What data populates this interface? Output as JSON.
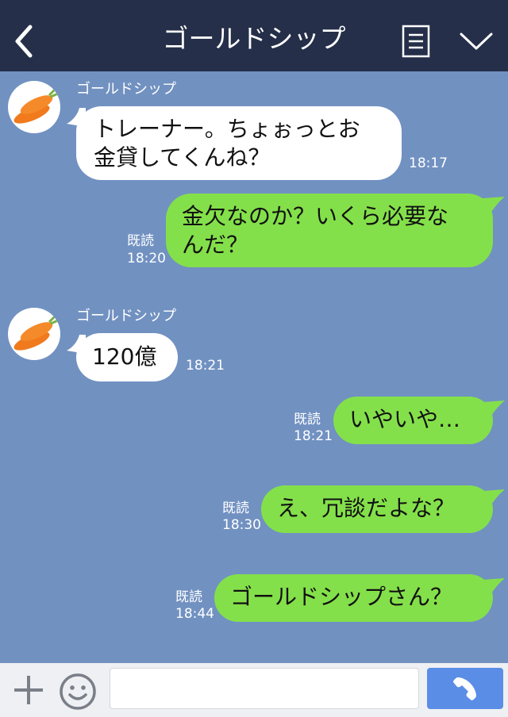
{
  "header": {
    "title": "ゴールドシップ",
    "back_icon": "chevron-left-icon",
    "menu_icon": "menu-list-icon",
    "collapse_icon": "chevron-down-icon"
  },
  "messages": [
    {
      "direction": "incoming",
      "sender": "ゴールドシップ",
      "lines": [
        "トレーナー。ちょぉっとお",
        "金貸してくんね？"
      ],
      "time": "18:17"
    },
    {
      "direction": "outgoing",
      "read": "既読",
      "lines": [
        "金欠なのか？いくら必要な",
        "んだ？"
      ],
      "time": "18:20"
    },
    {
      "direction": "incoming",
      "sender": "ゴールドシップ",
      "lines": [
        "120億"
      ],
      "time": "18:21"
    },
    {
      "direction": "outgoing",
      "read": "既読",
      "lines": [
        "いやいや…"
      ],
      "time": "18:21"
    },
    {
      "direction": "outgoing",
      "read": "既読",
      "lines": [
        "え、冗談だよな？"
      ],
      "time": "18:30"
    },
    {
      "direction": "outgoing",
      "read": "既読",
      "lines": [
        "ゴールドシップさん？"
      ],
      "time": "18:44"
    }
  ],
  "input_bar": {
    "plus_icon": "plus-icon",
    "emoji_icon": "smiley-icon",
    "message_value": "",
    "call_icon": "phone-icon"
  },
  "colors": {
    "header_bg": "#252f49",
    "chat_bg": "#7191c1",
    "incoming_bubble": "#ffffff",
    "outgoing_bubble": "#84e04a",
    "call_button": "#5a8de6"
  }
}
